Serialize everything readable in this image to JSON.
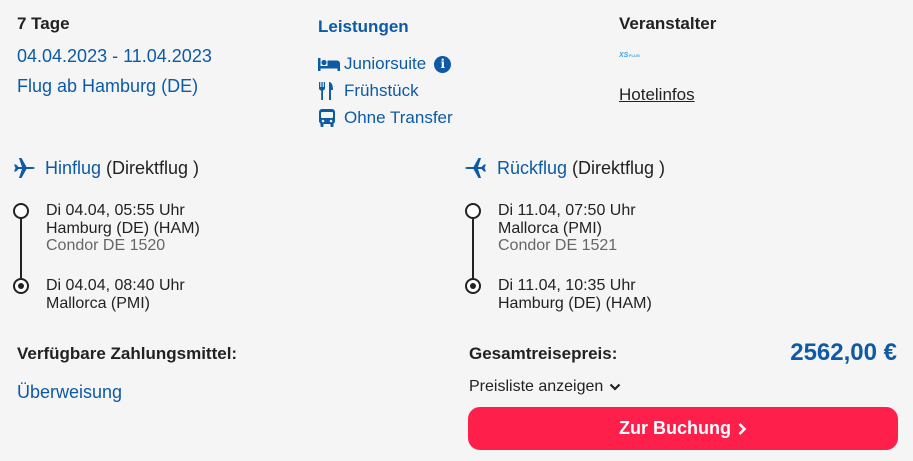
{
  "trip": {
    "duration": "7 Tage",
    "dates": "04.04.2023 - 11.04.2023",
    "departure": "Flug ab Hamburg (DE)"
  },
  "services": {
    "title": "Leistungen",
    "items": [
      {
        "label": "Juniorsuite",
        "icon": "bed-icon"
      },
      {
        "label": "Frühstück",
        "icon": "cutlery-icon"
      },
      {
        "label": "Ohne Transfer",
        "icon": "bus-icon"
      }
    ],
    "info_badge": "i"
  },
  "operator": {
    "title": "Veranstalter",
    "logo": "XS FLUG",
    "hotel_link": "Hotelinfos"
  },
  "outbound": {
    "label": "Hinflug",
    "type": "(Direktflug )",
    "depart_time": "Di 04.04, 05:55 Uhr",
    "depart_airport": "Hamburg (DE) (HAM)",
    "carrier": "Condor DE 1520",
    "arrive_time": "Di 04.04, 08:40 Uhr",
    "arrive_airport": "Mallorca (PMI)"
  },
  "return": {
    "label": "Rückflug",
    "type": "(Direktflug )",
    "depart_time": "Di 11.04, 07:50 Uhr",
    "depart_airport": "Mallorca (PMI)",
    "carrier": "Condor DE 1521",
    "arrive_time": "Di 11.04, 10:35 Uhr",
    "arrive_airport": "Hamburg (DE) (HAM)"
  },
  "payment": {
    "title": "Verfügbare Zahlungsmittel:",
    "method": "Überweisung"
  },
  "price": {
    "label": "Gesamtreisepreis:",
    "total": "2562,00 €",
    "pricelist_label": "Preisliste anzeigen",
    "book_label": "Zur Buchung"
  },
  "colors": {
    "accent_blue": "#0d5aa7",
    "book_button": "#ff1f4b"
  }
}
